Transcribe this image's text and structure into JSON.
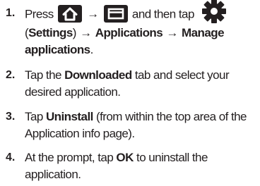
{
  "steps": [
    {
      "number": "1.",
      "line1": {
        "press": "Press",
        "arrow": "→",
        "then": "and then tap"
      },
      "line2": {
        "open": "(",
        "settings": "Settings",
        "close": ")",
        "arrow1": "→",
        "applications": "Applications",
        "arrow2": "→",
        "manage": "Manage"
      },
      "line3": {
        "applications": "applications",
        "period": "."
      }
    },
    {
      "number": "2.",
      "line1": {
        "before": "Tap the",
        "downloaded": "Downloaded",
        "after": "tab and select your"
      },
      "line2": {
        "text": "desired application."
      }
    },
    {
      "number": "3.",
      "line1": {
        "before": "Tap",
        "uninstall": "Uninstall",
        "after": "(from within the top area of the"
      },
      "line2": {
        "text": "Application info page)."
      }
    },
    {
      "number": "4.",
      "line1": {
        "before": "At the prompt, tap",
        "ok": "OK",
        "after": "to uninstall the"
      },
      "line2": {
        "text": "application."
      }
    }
  ],
  "icons": {
    "home": "home-key-icon",
    "menu": "menu-key-icon",
    "settings": "settings-gear-icon"
  },
  "colors": {
    "text": "#231f20",
    "icon_bg": "#231f20",
    "icon_fg": "#ffffff"
  }
}
